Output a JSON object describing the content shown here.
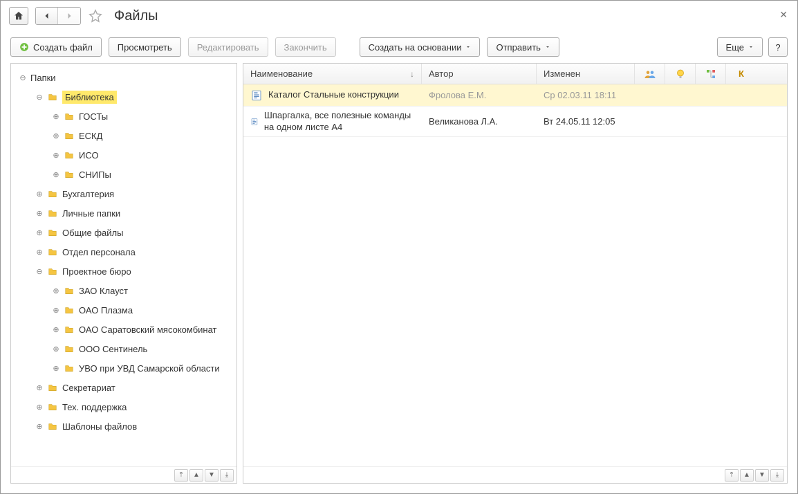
{
  "title": "Файлы",
  "toolbar": {
    "create_file": "Создать файл",
    "view": "Просмотреть",
    "edit": "Редактировать",
    "finish": "Закончить",
    "create_based_on": "Создать на основании",
    "send": "Отправить",
    "more": "Еще",
    "help": "?"
  },
  "tree": {
    "root": "Папки",
    "library": "Библиотека",
    "gosty": "ГОСТы",
    "eskd": "ЕСКД",
    "iso": "ИСО",
    "snipy": "СНИПы",
    "accounting": "Бухгалтерия",
    "personal": "Личные папки",
    "shared": "Общие файлы",
    "hr": "Отдел персонала",
    "pb": "Проектное бюро",
    "klaust": "ЗАО Клауст",
    "plazma": "ОАО Плазма",
    "sarat": "ОАО Саратовский мясокомбинат",
    "sentinel": "ООО Сентинель",
    "uvo": "УВО при УВД Самарской области",
    "secretariat": "Секретариат",
    "support": "Тех. поддержка",
    "templates": "Шаблоны файлов"
  },
  "columns": {
    "name": "Наименование",
    "author": "Автор",
    "changed": "Изменен",
    "s4": "К"
  },
  "rows": [
    {
      "name": "Каталог Стальные конструкции",
      "author": "Фролова Е.М.",
      "changed": "Ср 02.03.11 18:11",
      "selected": true,
      "muted": true
    },
    {
      "name": "Шпаргалка, все полезные команды на одном листе А4",
      "author": "Великанова Л.А.",
      "changed": "Вт 24.05.11 12:05",
      "selected": false,
      "muted": false
    }
  ]
}
